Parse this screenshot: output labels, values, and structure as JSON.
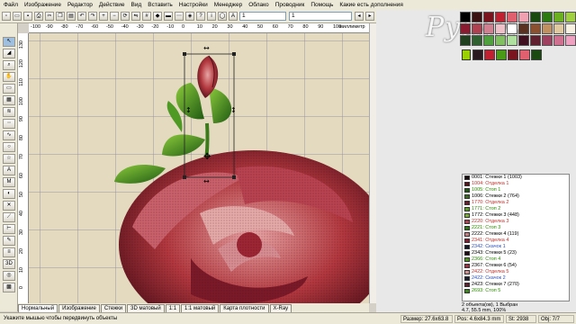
{
  "menu": [
    "Файл",
    "Изображение",
    "Редактор",
    "Действие",
    "Вид",
    "Вставить",
    "Настройки",
    "Менеджер",
    "Облако",
    "Проводник",
    "Помощь",
    "Какие есть дополнения"
  ],
  "toolbar": {
    "field1": "1",
    "field2": "1"
  },
  "ruler": {
    "unit": "миллиметр",
    "top_ticks": [
      "-100",
      "-90",
      "-80",
      "-70",
      "-60",
      "-50",
      "-40",
      "-30",
      "-20",
      "-10",
      "0",
      "10",
      "20",
      "30",
      "40",
      "50",
      "60",
      "70",
      "80",
      "90",
      "100"
    ],
    "left_ticks": [
      "130",
      "120",
      "110",
      "100",
      "90",
      "80",
      "70",
      "60",
      "50",
      "40",
      "30",
      "20",
      "10",
      "0"
    ]
  },
  "tabs": [
    "Нормальный",
    "Изображение",
    "Стежки",
    "3D матовый",
    "1:1",
    "1:1 матовый",
    "Карта плотности",
    "X-Ray"
  ],
  "status": {
    "hint": "Укажите мышью чтобы передвинуть объекты",
    "size": "Размер: 27.6x63.8 mm",
    "pos": "Pos: 4.6x84.3 mm",
    "stitches": "St: 2938",
    "objects": "Obj: 7/7"
  },
  "logo": "Руслан",
  "threads": [
    {
      "label": "0001: Стежки 1 (1003)",
      "color": "#1a0d10",
      "text_color": "#000000"
    },
    {
      "label": "1004: Отделка 1",
      "color": "#5a1018",
      "text_color": "#c0302a"
    },
    {
      "label": "1005: Стоп 1",
      "color": "#1c5a10",
      "text_color": "#2a8a00"
    },
    {
      "label": "1006: Стежки 2 (764)",
      "color": "#3a6a20",
      "text_color": "#000000"
    },
    {
      "label": "1770: Отделка 2",
      "color": "#6a1a28",
      "text_color": "#c0302a"
    },
    {
      "label": "1771: Стоп 2",
      "color": "#5aa020",
      "text_color": "#2a8a00"
    },
    {
      "label": "1772: Стежки 3 (448)",
      "color": "#7ab030",
      "text_color": "#000000"
    },
    {
      "label": "2220: Отделка 3",
      "color": "#b04050",
      "text_color": "#c0302a"
    },
    {
      "label": "2221: Стоп 3",
      "color": "#2a7a10",
      "text_color": "#2a8a00"
    },
    {
      "label": "2222: Стежки 4 (119)",
      "color": "#c88080",
      "text_color": "#000000"
    },
    {
      "label": "2341: Отделка 4",
      "color": "#8a1a30",
      "text_color": "#c0302a"
    },
    {
      "label": "2342: Скачок 1",
      "color": "#101828",
      "text_color": "#2a50c0"
    },
    {
      "label": "2343: Стежки 5 (23)",
      "color": "#200a14",
      "text_color": "#000000"
    },
    {
      "label": "2366: Стоп 4",
      "color": "#4a9a18",
      "text_color": "#2a8a00"
    },
    {
      "label": "2367: Стежки 6 (54)",
      "color": "#a03040",
      "text_color": "#000000"
    },
    {
      "label": "2422: Отделка 5",
      "color": "#d09090",
      "text_color": "#c0302a"
    },
    {
      "label": "2422: Скачок 2",
      "color": "#182030",
      "text_color": "#2a50c0"
    },
    {
      "label": "2423: Стежки 7 (270)",
      "color": "#602030",
      "text_color": "#000000"
    },
    {
      "label": "2693: Стоп 5",
      "color": "#3a8a18",
      "text_color": "#2a8a00"
    }
  ],
  "selection_info": "2 объекта(ов), 1 Выбран",
  "zoom_info": "4.7, 55.5 mm, 100%",
  "palette": [
    "#000000",
    "#3a1010",
    "#7a1520",
    "#c02030",
    "#e06070",
    "#f0a0b0",
    "#1a4a10",
    "#2a7a10",
    "#6ab020",
    "#a0d040",
    "#8a1a30",
    "#b04050",
    "#d08090",
    "#f0c0c8",
    "#ffffff",
    "#5a3020",
    "#8a5030",
    "#c09060",
    "#e0c8a0",
    "#f8f0e0",
    "#204020",
    "#306030",
    "#50a040",
    "#80c060",
    "#b0e0a0",
    "#401020",
    "#602030",
    "#a04060",
    "#d07090",
    "#f0a0c0"
  ],
  "swatches": [
    "#2a1a20",
    "#c02030",
    "#4a9a18",
    "#7a1520",
    "#e06070",
    "#1a4a10"
  ]
}
